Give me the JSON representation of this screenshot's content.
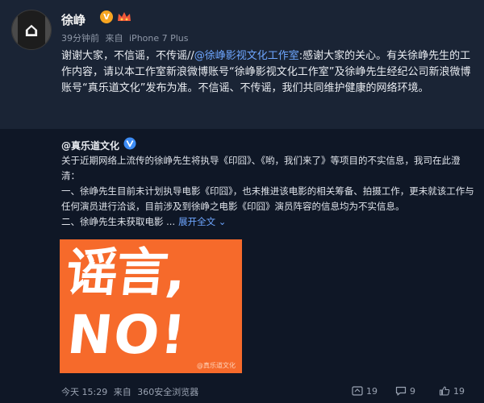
{
  "post": {
    "username": "徐峥",
    "v_badge": "V",
    "time": "39分钟前",
    "source_prefix": "来自",
    "source": "iPhone 7 Plus",
    "text_part1": "谢谢大家，不信谣，不传谣//",
    "mention": "@徐峥影视文化工作室",
    "text_part2": ":感谢大家的关心。有关徐峥先生的工作内容，请以本工作室新浪微博账号“徐峥影视文化工作室”及徐峥先生经纪公司新浪微博账号“真乐道文化”发布为准。不信谣、不传谣，我们共同维护健康的网络环境。"
  },
  "repost": {
    "author": "@真乐道文化",
    "paragraph1": "关于近期网络上流传的徐峥先生将执导《印囧》、《哟，我们来了》等项目的不实信息，我司在此澄清：",
    "paragraph2": "一、徐峥先生目前未计划执导电影《印囧》，也未推进该电影的相关筹备、拍摄工作，更未就该工作与任何演员进行洽谈，目前涉及到徐峥之电影《印囧》演员阵容的信息均为不实信息。",
    "paragraph3": "二、徐峥先生未获取电影 ...",
    "expand_label": "展开全文",
    "expand_arrow": "⌄",
    "poster_line1": "谣言,",
    "poster_line2": "NO!",
    "watermark": "@真乐道文化"
  },
  "footer": {
    "time": "今天 15:29",
    "source_prefix": "来自",
    "source": "360安全浏览器",
    "share_count": "19",
    "comment_count": "9",
    "like_count": "19"
  },
  "colors": {
    "background": "#0f1726",
    "post_background": "#1a2435",
    "link": "#6ea6ff",
    "poster": "#f66a2b",
    "vip_badge": "#f7a521"
  }
}
